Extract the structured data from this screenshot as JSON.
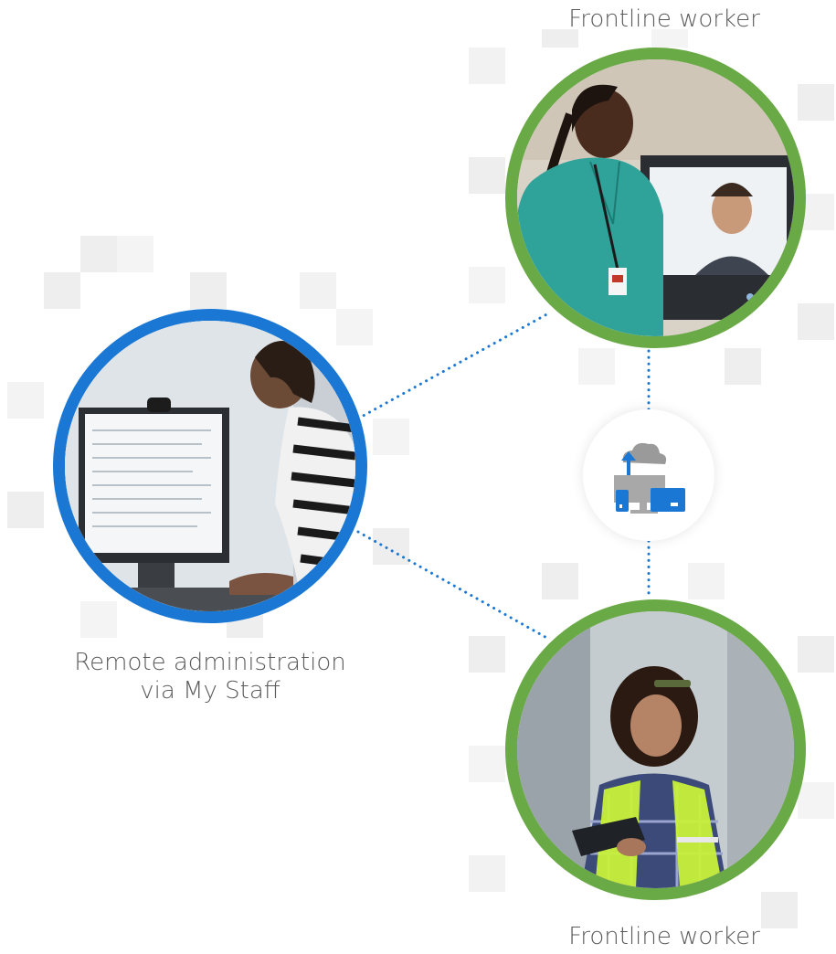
{
  "nodes": {
    "admin": {
      "caption_line1": "Remote administration",
      "caption_line2": "via My Staff",
      "ring_color": "#1a78d4"
    },
    "worker_top": {
      "caption": "Frontline worker",
      "ring_color": "#6aaa46"
    },
    "worker_bottom": {
      "caption": "Frontline worker",
      "ring_color": "#6aaa46"
    },
    "hub": {
      "icon": "cloud-upload-devices-icon",
      "accent": "#1a78d4"
    }
  },
  "connectors": {
    "style": "dotted",
    "color": "#1a78d4"
  }
}
